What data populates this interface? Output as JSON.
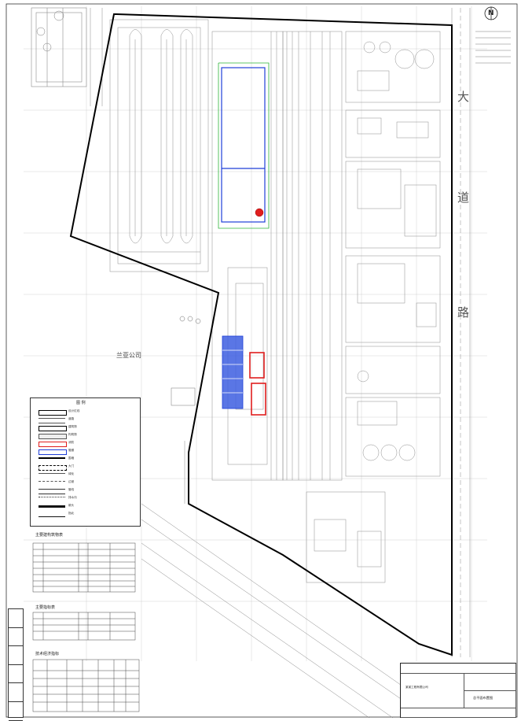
{
  "north_label": "N",
  "road_labels": [
    "大",
    "道",
    "路"
  ],
  "neighbor_company": "兰亚公司",
  "legend": {
    "title": "图 例",
    "items": [
      "设计红线",
      "道路",
      "建筑物",
      "构筑物",
      "消防",
      "管廊",
      "围墙",
      "大门",
      "绿化",
      "边坡",
      "管线",
      "排水沟",
      "箭头",
      "指北"
    ]
  },
  "section_titles": [
    "主要建构筑物表",
    "主要指标表",
    "技术经济指标"
  ],
  "title_block": {
    "company": "某某工程有限公司",
    "drawing_title": "总平面布置图"
  },
  "colors": {
    "boundary": "#000000",
    "drawing_lines": "#8c8c8c",
    "blue_zone": "#1f3fd8",
    "red_zone": "#e01e1e",
    "green_line": "#2fb53a"
  }
}
